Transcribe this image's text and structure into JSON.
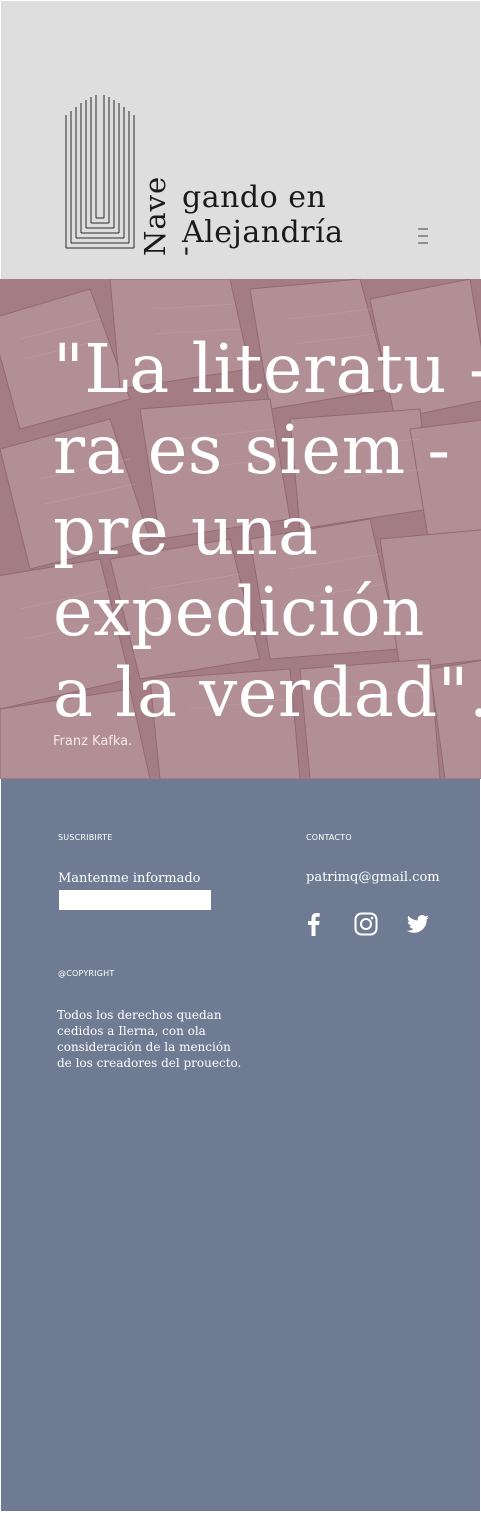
{
  "header": {
    "logo": {
      "vertical_text": "Nave -",
      "line1": "gando en",
      "line2": "Alejandría"
    }
  },
  "hero": {
    "quote_lines": [
      "\"La literatu -",
      "ra es siem -",
      "pre una",
      "expedición",
      "a la verdad\"."
    ],
    "author": "Franz Kafka."
  },
  "footer": {
    "subscribe": {
      "heading": "SUSCRIBIRTE",
      "label": "Mantenme informado",
      "input_value": ""
    },
    "contact": {
      "heading": "CONTACTO",
      "email": "patrimq@gmail.com"
    },
    "copyright": {
      "heading": "@COPYRIGHT",
      "text": "Todos los derechos quedan cedidos a Ilerna, con ola consideración de la mención de los creadores del prouecto."
    },
    "social_icons": [
      "facebook-icon",
      "instagram-icon",
      "twitter-icon"
    ]
  },
  "colors": {
    "header_bg": "#dedede",
    "hero_tint": "#a9868b",
    "footer_bg": "#6f7a93",
    "text_light": "#ffffff"
  }
}
